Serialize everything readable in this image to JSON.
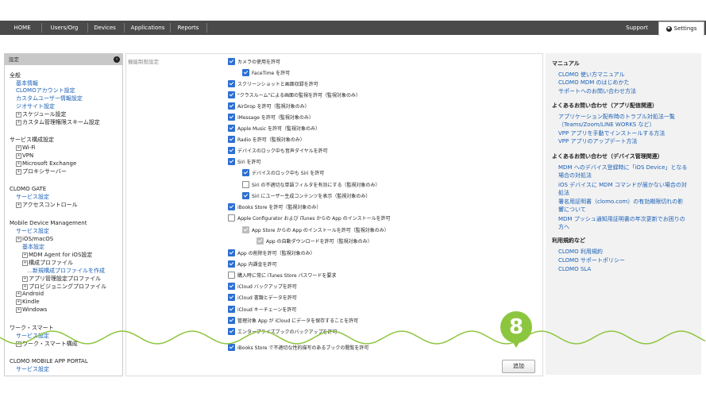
{
  "nav": {
    "items": [
      "HOME",
      "Users/Org",
      "Devices",
      "Applications",
      "Reports"
    ],
    "support": "Support",
    "settings": "Settings"
  },
  "sidebar": {
    "header": "設定",
    "lines": [
      {
        "text": "全般",
        "type": "h"
      },
      {
        "text": "基本情報",
        "type": "link"
      },
      {
        "text": "CLOMOアカウント設定",
        "type": "link"
      },
      {
        "text": "カスタムユーザー情報設定",
        "type": "link"
      },
      {
        "text": "ジオサイト設定",
        "type": "link"
      },
      {
        "text": "スケジュール設定",
        "type": "pm"
      },
      {
        "text": "カスタム管理権限スキーム設定",
        "type": "pm"
      },
      {
        "text": "サービス構成設定",
        "type": "h"
      },
      {
        "text": "Wi-Fi",
        "type": "pm"
      },
      {
        "text": "VPN",
        "type": "pm"
      },
      {
        "text": "Microsoft Exchange",
        "type": "pm"
      },
      {
        "text": "プロキシサーバー",
        "type": "pm"
      },
      {
        "text": "CLOMO GATE",
        "type": "h"
      },
      {
        "text": "サービス設定",
        "type": "link"
      },
      {
        "text": "アクセスコントロール",
        "type": "pm"
      },
      {
        "text": "Mobile Device Management",
        "type": "h"
      },
      {
        "text": "サービス設定",
        "type": "link"
      },
      {
        "text": "iOS/macOS",
        "type": "pm"
      },
      {
        "text": "基本設定",
        "type": "link"
      },
      {
        "text": "MDM Agent for iOS設定",
        "type": "pm"
      },
      {
        "text": "構成プロファイル",
        "type": "pm"
      },
      {
        "text": "…新規構成プロファイルを作成",
        "type": "link"
      },
      {
        "text": "アプリ管理設定プロファイル",
        "type": "pm"
      },
      {
        "text": "プロビジョニングプロファイル",
        "type": "pm"
      },
      {
        "text": "Android",
        "type": "pm"
      },
      {
        "text": "Kindle",
        "type": "pm"
      },
      {
        "text": "Windows",
        "type": "pm"
      },
      {
        "text": "ワーク・スマート",
        "type": "h"
      },
      {
        "text": "サービス設定",
        "type": "link"
      },
      {
        "text": "ワーク・スマート構成",
        "type": "pm"
      },
      {
        "text": "CLOMO MOBILE APP PORTAL",
        "type": "h"
      },
      {
        "text": "サービス設定",
        "type": "link"
      }
    ]
  },
  "main": {
    "title": "機能制限設定",
    "checkboxes": [
      {
        "label": "カメラの使用を許可",
        "checked": true,
        "disabled": false
      },
      {
        "label": "FaceTime を許可",
        "checked": true,
        "disabled": false
      },
      {
        "label": "スクリーンショットと画面収録を許可",
        "checked": true,
        "disabled": false
      },
      {
        "label": "\"クラスルーム\"による画面の監視を許可（監視対象のみ）",
        "checked": true,
        "disabled": false
      },
      {
        "label": "AirDrop を許可（監視対象のみ）",
        "checked": true,
        "disabled": false
      },
      {
        "label": "iMessage を許可（監視対象のみ）",
        "checked": true,
        "disabled": false
      },
      {
        "label": "Apple Music を許可（監視対象のみ）",
        "checked": true,
        "disabled": false
      },
      {
        "label": "Radio を許可（監視対象のみ）",
        "checked": true,
        "disabled": false
      },
      {
        "label": "デバイスのロック中も音声ダイヤルを許可",
        "checked": true,
        "disabled": false
      },
      {
        "label": "Siri を許可",
        "checked": true,
        "disabled": false
      },
      {
        "label": "デバイスのロック中も Siri を許可",
        "checked": true,
        "disabled": false
      },
      {
        "label": "Siri の不適切な単語フィルタを有効にする（監視対象のみ）",
        "checked": false,
        "disabled": false
      },
      {
        "label": "Siri にユーザー生成コンテンツを表示（監視対象のみ）",
        "checked": true,
        "disabled": false
      },
      {
        "label": "iBooks Store を許可（監視対象のみ）",
        "checked": true,
        "disabled": false
      },
      {
        "label": "Apple Configurator および iTunes からの App のインストールを許可",
        "checked": false,
        "disabled": false
      },
      {
        "label": "App Store からの App のインストールを許可（監視対象のみ）",
        "checked": true,
        "disabled": true
      },
      {
        "label": "App の自動ダウンロードを許可（監視対象のみ）",
        "checked": true,
        "disabled": true
      },
      {
        "label": "App の削除を許可（監視対象のみ）",
        "checked": true,
        "disabled": false
      },
      {
        "label": "App 内課金を許可",
        "checked": true,
        "disabled": false
      },
      {
        "label": "購入時に常に iTunes Store パスワードを要求",
        "checked": false,
        "disabled": false
      },
      {
        "label": "iCloud バックアップを許可",
        "checked": true,
        "disabled": false
      },
      {
        "label": "iCloud 書類とデータを許可",
        "checked": true,
        "disabled": false
      },
      {
        "label": "iCloud キーチェーンを許可",
        "checked": true,
        "disabled": false
      },
      {
        "label": "管理対象 App が iCloud にデータを保存することを許可",
        "checked": true,
        "disabled": false
      },
      {
        "label": "エンタープライズブックのバックアップを許可",
        "checked": true,
        "disabled": false
      },
      {
        "label": "iBooks Store で不適切な性的描写のあるブックの閲覧を許可",
        "checked": true,
        "disabled": false
      }
    ],
    "add_button": "追加"
  },
  "right": {
    "lines": [
      {
        "text": "マニュアル",
        "type": "h"
      },
      {
        "text": "CLOMO 使い方マニュアル",
        "type": "link"
      },
      {
        "text": "CLOMO MDM のはじめかた",
        "type": "link"
      },
      {
        "text": "サポートへのお問い合わせ方法",
        "type": "link"
      },
      {
        "text": "よくあるお問い合わせ（アプリ配信関連）",
        "type": "h"
      },
      {
        "text": "アプリケーション配布時のトラブル対処法一覧",
        "type": "link"
      },
      {
        "text": "（Teams/Zoom/LINE WORKS など）",
        "type": "link"
      },
      {
        "text": "VPP アプリを手動でインストールする方法",
        "type": "link"
      },
      {
        "text": "VPP アプリのアップデート方法",
        "type": "link"
      },
      {
        "text": "よくあるお問い合わせ（デバイス管理関連）",
        "type": "h"
      },
      {
        "text": "MDM へのデバイス登録時に「iOS Device」となる",
        "type": "link"
      },
      {
        "text": "場合の対処法",
        "type": "link"
      },
      {
        "text": "iOS デバイスに MDM コマンドが届かない場合の対",
        "type": "link"
      },
      {
        "text": "処法",
        "type": "link"
      },
      {
        "text": "署名用証明書（clomo.com）の有効期限切れの影",
        "type": "link"
      },
      {
        "text": "響について",
        "type": "link"
      },
      {
        "text": "MDM プッシュ通知用証明書の年次更新でお困りの",
        "type": "link"
      },
      {
        "text": "方へ",
        "type": "link"
      },
      {
        "text": "利用規約など",
        "type": "h"
      },
      {
        "text": "CLOMO 利用規約",
        "type": "link"
      },
      {
        "text": "CLOMO サポートポリシー",
        "type": "link"
      },
      {
        "text": "CLOMO SLA",
        "type": "link"
      }
    ]
  },
  "step_badge": "8",
  "colors": {
    "nav_bg": "#4a4a4a",
    "badge": "#8cc63f",
    "link": "#1a5fb4",
    "checkbox": "#2d6fd3"
  }
}
